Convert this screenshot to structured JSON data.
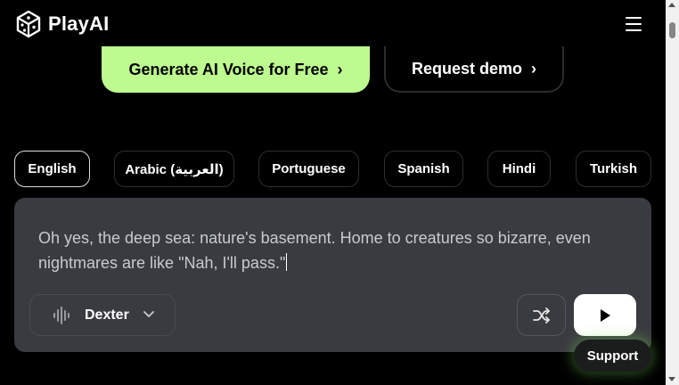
{
  "nav": {
    "brand": "PlayAI",
    "logo_icon": "dice-cube-icon",
    "menu_icon": "hamburger-menu-icon"
  },
  "hero": {
    "primary_label": "Generate AI Voice for Free",
    "secondary_label": "Request demo",
    "primary_color": "#bdfa8f"
  },
  "languages": {
    "selected": "English",
    "items": [
      "English",
      "Arabic (العربية)",
      "Portuguese",
      "Spanish",
      "Hindi",
      "Turkish"
    ]
  },
  "editor": {
    "text": "Oh yes, the deep sea: nature's basement. Home to creatures so bizarre, even nightmares are like \"Nah, I'll pass.\"",
    "voice": "Dexter",
    "voice_icon": "audio-waveform-icon",
    "shuffle_icon": "shuffle-icon",
    "play_icon": "play-icon"
  },
  "support": {
    "label": "Support"
  }
}
